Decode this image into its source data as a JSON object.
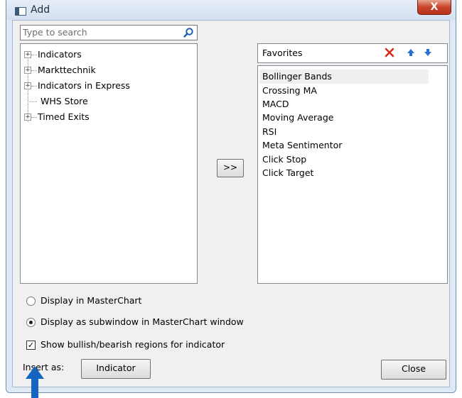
{
  "window": {
    "title": "Add",
    "close_glyph": "X"
  },
  "search": {
    "placeholder": "Type to search",
    "value": ""
  },
  "tree": {
    "items": [
      {
        "label": "Indicators",
        "expandable": true,
        "expander": "+"
      },
      {
        "label": "Markttechnik",
        "expandable": true,
        "expander": "+"
      },
      {
        "label": "Indicators in Express",
        "expandable": true,
        "expander": "+"
      },
      {
        "label": "WHS Store",
        "expandable": false,
        "expander": ""
      },
      {
        "label": "Timed Exits",
        "expandable": true,
        "expander": "+"
      }
    ]
  },
  "move_button": {
    "label": ">>"
  },
  "favorites": {
    "title": "Favorites",
    "icons": {
      "delete": "delete-icon",
      "up": "move-up-icon",
      "down": "move-down-icon"
    },
    "items": [
      {
        "label": "Bollinger Bands",
        "selected": true
      },
      {
        "label": "Crossing MA",
        "selected": false
      },
      {
        "label": "MACD",
        "selected": false
      },
      {
        "label": "Moving Average",
        "selected": false
      },
      {
        "label": "RSI",
        "selected": false
      },
      {
        "label": "Meta Sentimentor",
        "selected": false
      },
      {
        "label": "Click Stop",
        "selected": false
      },
      {
        "label": "Click Target",
        "selected": false
      }
    ]
  },
  "options": {
    "display_master": {
      "label": "Display in MasterChart",
      "checked": false
    },
    "display_sub": {
      "label": "Display as subwindow in MasterChart window",
      "checked": true
    },
    "show_regions": {
      "label": "Show bullish/bearish regions for indicator",
      "checked": true,
      "mark": "✓"
    }
  },
  "insert": {
    "label": "Insert as:",
    "button": "Indicator"
  },
  "close_button": {
    "label": "Close"
  },
  "colors": {
    "accent_arrow": "#1565c0",
    "delete_red": "#d92b1c",
    "arrow_blue": "#2a6fd6"
  }
}
